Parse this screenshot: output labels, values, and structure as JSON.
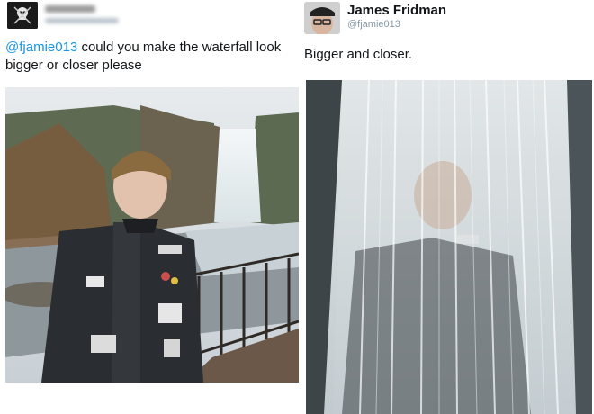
{
  "original_tweet": {
    "avatar_icon": "skull-logo-icon",
    "text_mention": "@fjamie013",
    "text_body": " could you make the waterfall look bigger or closer please",
    "photo_icon": "photo-waterfall-original"
  },
  "reply_tweet": {
    "display_name": "James Fridman",
    "handle": "@fjamie013",
    "avatar_icon": "user-avatar-icon",
    "text": "Bigger and closer.",
    "photo_icon": "photo-waterfall-edited"
  },
  "colors": {
    "mention": "#1b95e0",
    "text": "#14171a",
    "handle": "#8899a6"
  }
}
